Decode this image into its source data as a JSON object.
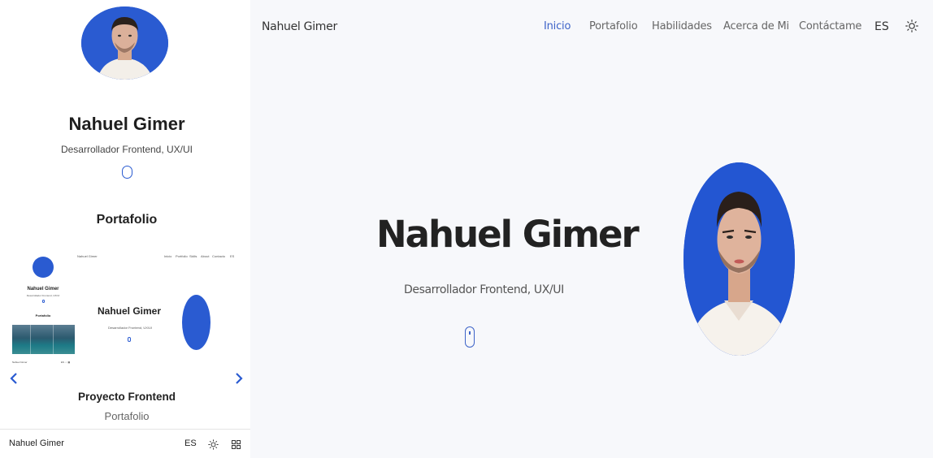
{
  "mobile": {
    "name": "Nahuel Gimer",
    "role": "Desarrollador Frontend, UX/UI",
    "portfolio_title": "Portafolio",
    "project_title": "Proyecto Frontend",
    "project_subtitle": "Portafolio",
    "bottom_bar": {
      "name": "Nahuel Gimer",
      "lang": "ES"
    },
    "arrows": {
      "prev": "‹",
      "next": "›"
    },
    "thumbnail": {
      "logo": "Nahuel Gimer",
      "nav": [
        "Inicio",
        "Portfolio",
        "Skills",
        "About",
        "Contacto",
        "ES"
      ],
      "left_name": "Nahuel Gimer",
      "left_role": "Desarrollador Frontend, UX/UI",
      "left_section": "Portafolio",
      "bottom_name": "Nahuel Gimer",
      "bottom_icons": "ES ☼ ▦",
      "hero_name": "Nahuel Gimer",
      "hero_role": "Desarrollador Frontend, UX/UI"
    }
  },
  "header": {
    "logo": "Nahuel Gimer",
    "nav": {
      "inicio": "Inicio",
      "portafolio": "Portafolio",
      "habilidades": "Habilidades",
      "acerca": "Acerca de Mi",
      "contacto": "Contáctame"
    },
    "lang": "ES"
  },
  "hero": {
    "name": "Nahuel Gimer",
    "role": "Desarrollador Frontend, UX/UI"
  },
  "colors": {
    "accent": "#3d63c8",
    "photo_bg": "#2356d2"
  }
}
